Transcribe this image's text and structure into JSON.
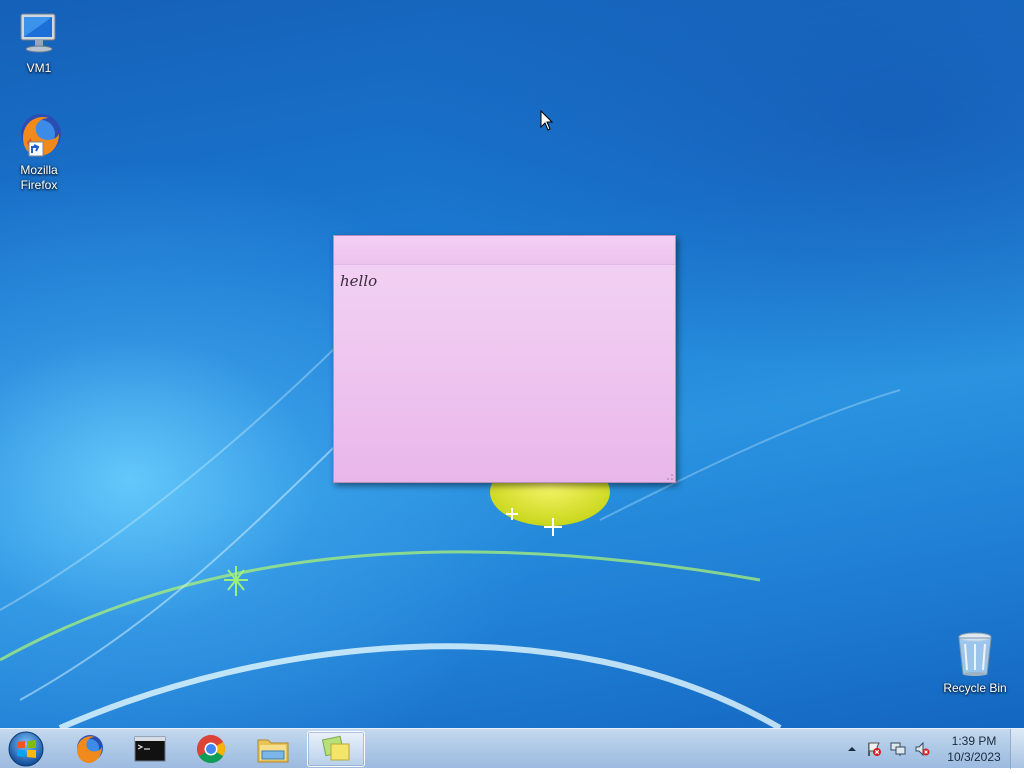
{
  "desktop": {
    "icons": [
      {
        "label": "VM1",
        "icon": "computer-icon"
      },
      {
        "label": "Mozilla\nFirefox",
        "icon": "firefox-icon"
      },
      {
        "label": "Recycle Bin",
        "icon": "recycle-bin-icon"
      }
    ]
  },
  "sticky_note": {
    "text": "hello",
    "color": "#efc8f0"
  },
  "taskbar": {
    "start": {
      "icon": "windows-start-orb-icon"
    },
    "pinned": [
      {
        "name": "Firefox",
        "icon": "firefox-icon"
      },
      {
        "name": "Command Prompt",
        "icon": "cmd-icon"
      },
      {
        "name": "Chrome",
        "icon": "chrome-icon"
      },
      {
        "name": "File Explorer",
        "icon": "folder-icon"
      },
      {
        "name": "Sticky Notes",
        "icon": "sticky-notes-icon",
        "active": true
      }
    ],
    "tray": {
      "icons": [
        "show-hidden-icons-chevron",
        "action-center-flag-icon",
        "network-icon",
        "volume-muted-icon"
      ],
      "time": "1:39 PM",
      "date": "10/3/2023"
    }
  },
  "colors": {
    "desktop_blue": "#1a78d0",
    "taskbar": "#b1cbe8",
    "note_pink": "#efc8f0"
  }
}
